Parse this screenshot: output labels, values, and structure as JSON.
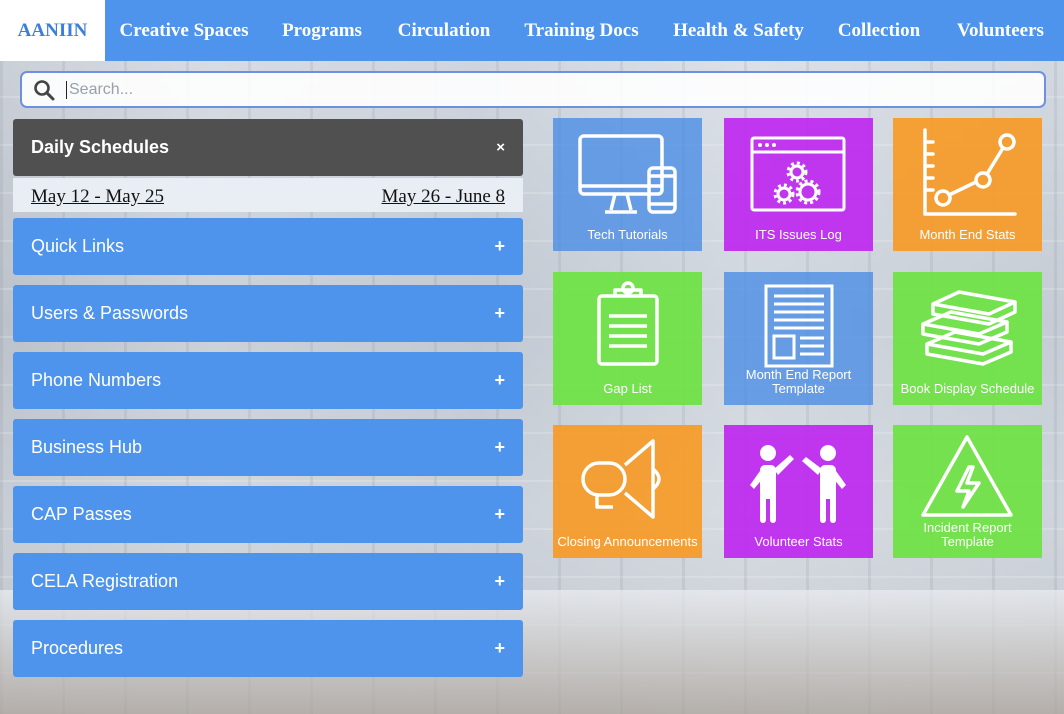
{
  "nav": {
    "items": [
      {
        "label": "AANIIN",
        "active": true
      },
      {
        "label": "Creative Spaces"
      },
      {
        "label": "Programs"
      },
      {
        "label": "Circulation"
      },
      {
        "label": "Training Docs"
      },
      {
        "label": "Health & Safety"
      },
      {
        "label": "Collection"
      },
      {
        "label": "Volunteers"
      }
    ]
  },
  "search": {
    "placeholder": "Search...",
    "icon": "search-icon"
  },
  "accordion": {
    "daily": {
      "title": "Daily Schedules",
      "toggle": "×",
      "expanded": true
    },
    "schedules": {
      "first": "May 12 - May 25",
      "second": "May 26 - June 8"
    },
    "panels": [
      {
        "title": "Quick Links",
        "toggle": "+"
      },
      {
        "title": "Users & Passwords",
        "toggle": "+"
      },
      {
        "title": "Phone Numbers",
        "toggle": "+"
      },
      {
        "title": "Business Hub",
        "toggle": "+"
      },
      {
        "title": "CAP Passes",
        "toggle": "+"
      },
      {
        "title": "CELA Registration",
        "toggle": "+"
      },
      {
        "title": "Procedures",
        "toggle": "+"
      }
    ]
  },
  "tiles": [
    {
      "label": "Tech Tutorials",
      "icon": "devices-icon",
      "color": "#4a8ce6"
    },
    {
      "label": "ITS Issues Log",
      "icon": "gears-window-icon",
      "color": "#bf28f0"
    },
    {
      "label": "Month End Stats",
      "icon": "line-chart-icon",
      "color": "#f69b28"
    },
    {
      "label": "Gap List",
      "icon": "clipboard-icon",
      "color": "#6ee244"
    },
    {
      "label": "Month End Report Template",
      "icon": "document-icon",
      "color": "#4a8ce6"
    },
    {
      "label": "Book Display Schedule",
      "icon": "books-icon",
      "color": "#6ee244"
    },
    {
      "label": "Closing Announcements",
      "icon": "megaphone-icon",
      "color": "#f69b28"
    },
    {
      "label": "Volunteer Stats",
      "icon": "people-icon",
      "color": "#bf28f0"
    },
    {
      "label": "Incident Report Template",
      "icon": "warning-icon",
      "color": "#6ee244"
    }
  ],
  "colors": {
    "accent": "#4f94ec",
    "dark_header": "#505050"
  }
}
